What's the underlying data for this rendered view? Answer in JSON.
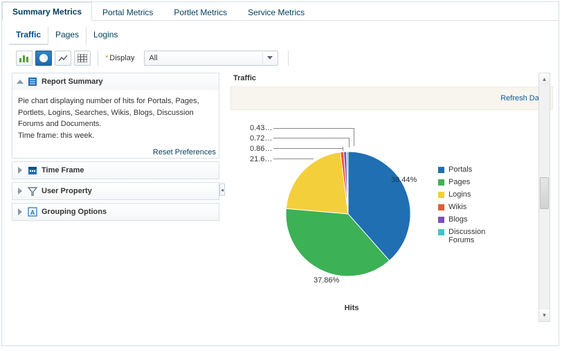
{
  "topTabs": {
    "items": [
      "Summary Metrics",
      "Portal Metrics",
      "Portlet Metrics",
      "Service Metrics"
    ],
    "activeIndex": 0
  },
  "subTabs": {
    "items": [
      "Traffic",
      "Pages",
      "Logins"
    ],
    "activeIndex": 0
  },
  "toolbar": {
    "display_prefix": "Display",
    "display_value": "All"
  },
  "sidebar": {
    "report_summary": {
      "title": "Report Summary",
      "body": "Pie chart displaying number of hits for Portals, Pages, Portlets, Logins, Searches, Wikis, Blogs, Discussion Forums and Documents.\nTime frame: this week.",
      "reset": "Reset Preferences"
    },
    "time_frame": {
      "title": "Time Frame"
    },
    "user_property": {
      "title": "User Property"
    },
    "grouping": {
      "title": "Grouping Options"
    }
  },
  "chart": {
    "title": "Traffic",
    "refresh": "Refresh Data",
    "xlabel": "Hits",
    "big_label_right": "38.44%",
    "big_label_bottom": "37.86%",
    "small_labels": [
      "0.43…",
      "0.72…",
      "0.86…",
      "21.6…"
    ]
  },
  "legend_names": [
    "Portals",
    "Pages",
    "Logins",
    "Wikis",
    "Blogs",
    "Discussion Forums"
  ],
  "chart_data": {
    "type": "pie",
    "title": "Traffic",
    "xlabel": "Hits",
    "series": [
      {
        "name": "Portals",
        "value": 38.44,
        "color": "#1f6fb2"
      },
      {
        "name": "Pages",
        "value": 37.86,
        "color": "#3cb156"
      },
      {
        "name": "Logins",
        "value": 21.6,
        "color": "#f4cf3c"
      },
      {
        "name": "Wikis",
        "value": 0.86,
        "color": "#e65a33"
      },
      {
        "name": "Blogs",
        "value": 0.72,
        "color": "#7a4fbf"
      },
      {
        "name": "Discussion Forums",
        "value": 0.43,
        "color": "#3cc7c7"
      }
    ]
  }
}
